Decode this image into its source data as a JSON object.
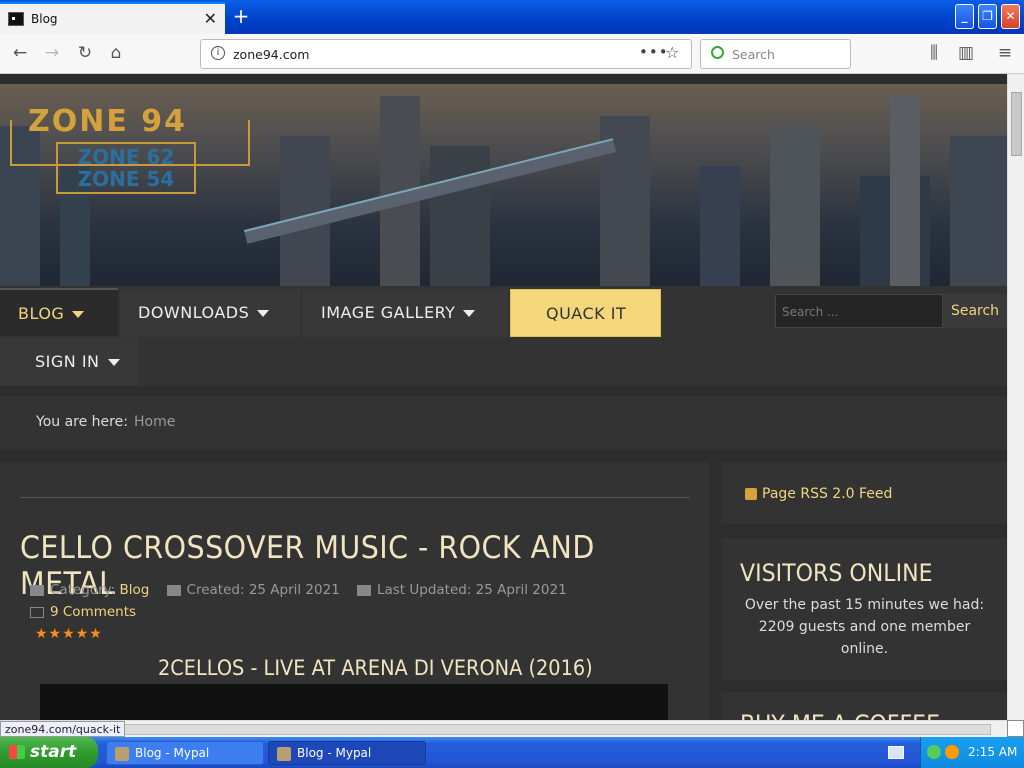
{
  "browser": {
    "tab_title": "Blog",
    "new_tab": "+",
    "url": "zone94.com",
    "url_more": "•••",
    "search_placeholder": "Search"
  },
  "window": {
    "minimize": "_",
    "restore": "❐",
    "close": "✕"
  },
  "site": {
    "logo_main": "ZONE 94",
    "logo_sub1": "ZONE 62",
    "logo_sub2": "ZONE 54",
    "menu": [
      "BLOG",
      "DOWNLOADS",
      "IMAGE GALLERY",
      "QUACK IT",
      "SIGN IN"
    ],
    "search_placeholder": "Search ...",
    "search_button": "Search",
    "breadcrumb_label": "You are here:",
    "breadcrumb_home": "Home"
  },
  "article": {
    "title": "CELLO CROSSOVER MUSIC - ROCK AND METAL",
    "category_label": "Category:",
    "category": "Blog",
    "created": "Created: 25 April 2021",
    "updated": "Last Updated: 25 April 2021",
    "comments": "9 Comments",
    "rating": "★★★★★",
    "subtitle": "2CELLOS - LIVE AT ARENA DI VERONA (2016)"
  },
  "sidebar": {
    "rss": "Page RSS 2.0 Feed",
    "visitors_title": "VISITORS ONLINE",
    "visitors_text": "Over the past 15 minutes we had: 2209 guests and one member online.",
    "coffee_title": "BUY ME A COFFEE"
  },
  "status_url": "zone94.com/quack-it",
  "taskbar": {
    "start": "start",
    "tasks": [
      "Blog - Mypal",
      "Blog - Mypal"
    ],
    "time": "2:15 AM"
  },
  "colors": {
    "accent": "#f1d57e",
    "highlight": "#f4d77b",
    "background": "#2d2d2d"
  }
}
